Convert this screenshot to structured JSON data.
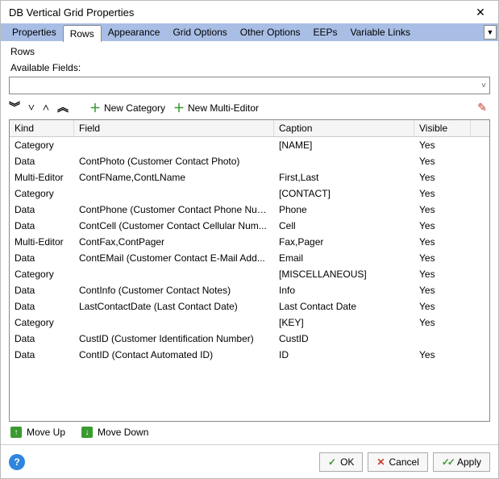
{
  "window": {
    "title": "DB Vertical Grid Properties"
  },
  "tabs": [
    {
      "label": "Properties"
    },
    {
      "label": "Rows"
    },
    {
      "label": "Appearance"
    },
    {
      "label": "Grid Options"
    },
    {
      "label": "Other Options"
    },
    {
      "label": "EEPs"
    },
    {
      "label": "Variable Links"
    }
  ],
  "activeTab": 1,
  "subheader": "Rows",
  "availableFieldsLabel": "Available Fields:",
  "toolbar": {
    "newCategory": "New Category",
    "newMultiEditor": "New Multi-Editor"
  },
  "columns": {
    "kind": "Kind",
    "field": "Field",
    "caption": "Caption",
    "visible": "Visible"
  },
  "rows": [
    {
      "kind": "Category",
      "field": "",
      "caption": "[NAME]",
      "visible": "Yes"
    },
    {
      "kind": "Data",
      "field": "ContPhoto  (Customer Contact Photo)",
      "caption": "",
      "visible": "Yes"
    },
    {
      "kind": "Multi-Editor",
      "field": "ContFName,ContLName",
      "caption": "First,Last",
      "visible": "Yes"
    },
    {
      "kind": "Category",
      "field": "",
      "caption": "[CONTACT]",
      "visible": "Yes"
    },
    {
      "kind": "Data",
      "field": "ContPhone  (Customer Contact Phone Num...",
      "caption": "Phone",
      "visible": "Yes"
    },
    {
      "kind": "Data",
      "field": "ContCell  (Customer Contact Cellular Num...",
      "caption": "Cell",
      "visible": "Yes"
    },
    {
      "kind": "Multi-Editor",
      "field": "ContFax,ContPager",
      "caption": "Fax,Pager",
      "visible": "Yes"
    },
    {
      "kind": "Data",
      "field": "ContEMail  (Customer Contact E-Mail Add...",
      "caption": "Email",
      "visible": "Yes"
    },
    {
      "kind": "Category",
      "field": "",
      "caption": "[MISCELLANEOUS]",
      "visible": "Yes"
    },
    {
      "kind": "Data",
      "field": "ContInfo  (Customer Contact Notes)",
      "caption": "Info",
      "visible": "Yes"
    },
    {
      "kind": "Data",
      "field": "LastContactDate  (Last Contact Date)",
      "caption": "Last Contact Date",
      "visible": "Yes"
    },
    {
      "kind": "Category",
      "field": "",
      "caption": "[KEY]",
      "visible": "Yes"
    },
    {
      "kind": "Data",
      "field": "CustID  (Customer Identification Number)",
      "caption": "CustID",
      "visible": ""
    },
    {
      "kind": "Data",
      "field": "ContID  (Contact Automated ID)",
      "caption": "ID",
      "visible": "Yes"
    }
  ],
  "move": {
    "up": "Move Up",
    "down": "Move Down"
  },
  "buttons": {
    "ok": "OK",
    "cancel": "Cancel",
    "apply": "Apply"
  }
}
